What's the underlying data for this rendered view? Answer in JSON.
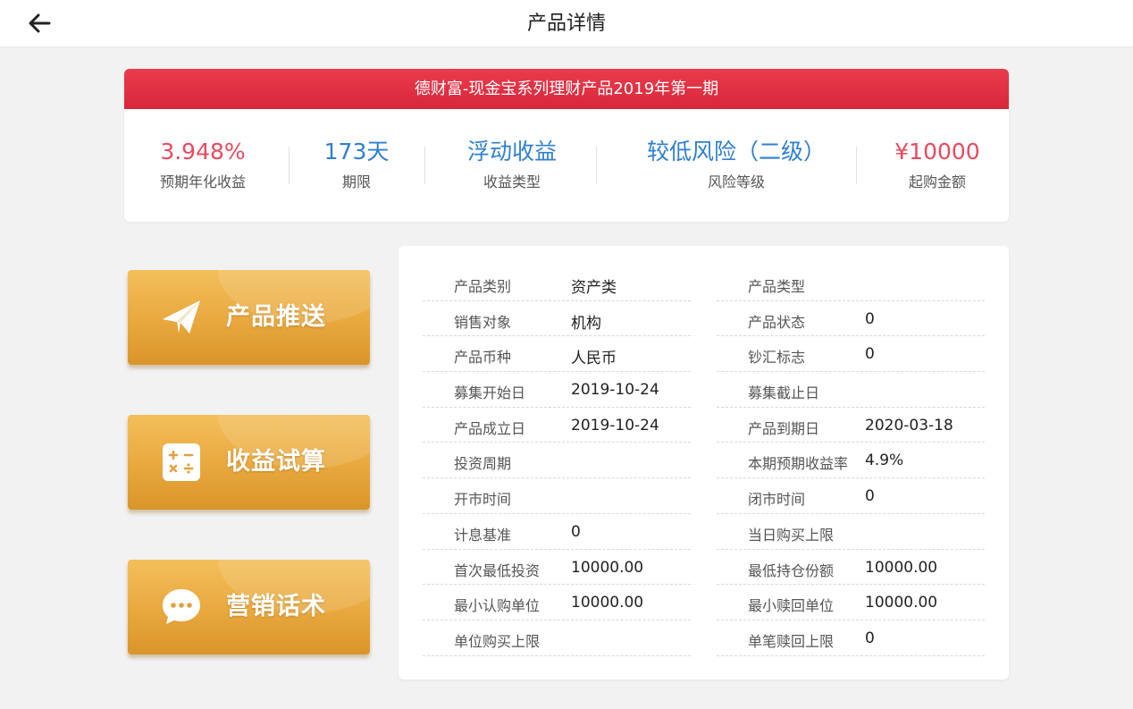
{
  "header": {
    "title": "产品详情",
    "back_icon": "arrow-left-icon"
  },
  "product": {
    "name": "德财富-现金宝系列理财产品2019年第一期",
    "stats": [
      {
        "value": "3.948%",
        "label": "预期年化收益",
        "color": "#e84a5f"
      },
      {
        "value": "173天",
        "label": "期限",
        "color": "#2f7fd0"
      },
      {
        "value": "浮动收益",
        "label": "收益类型",
        "color": "#2f7fd0"
      },
      {
        "value": "较低风险（二级）",
        "label": "风险等级",
        "color": "#2f7fd0"
      },
      {
        "value": "¥10000",
        "label": "起购金额",
        "color": "#e84a5f"
      }
    ]
  },
  "actions": [
    {
      "label": "产品推送",
      "icon": "paper-plane-icon"
    },
    {
      "label": "收益试算",
      "icon": "calculator-icon"
    },
    {
      "label": "营销话术",
      "icon": "chat-bubble-icon"
    }
  ],
  "details": {
    "left": [
      {
        "key": "产品类别",
        "value": "资产类"
      },
      {
        "key": "销售对象",
        "value": "机构"
      },
      {
        "key": "产品币种",
        "value": "人民币"
      },
      {
        "key": "募集开始日",
        "value": "2019-10-24"
      },
      {
        "key": "产品成立日",
        "value": "2019-10-24"
      },
      {
        "key": "投资周期",
        "value": ""
      },
      {
        "key": "开市时间",
        "value": ""
      },
      {
        "key": "计息基准",
        "value": "0"
      },
      {
        "key": "首次最低投资",
        "value": "10000.00"
      },
      {
        "key": "最小认购单位",
        "value": "10000.00"
      },
      {
        "key": "单位购买上限",
        "value": ""
      }
    ],
    "right": [
      {
        "key": "产品类型",
        "value": ""
      },
      {
        "key": "产品状态",
        "value": "0"
      },
      {
        "key": "钞汇标志",
        "value": "0"
      },
      {
        "key": "募集截止日",
        "value": ""
      },
      {
        "key": "产品到期日",
        "value": "2020-03-18"
      },
      {
        "key": "本期预期收益率",
        "value": "4.9%"
      },
      {
        "key": "闭市时间",
        "value": "0"
      },
      {
        "key": "当日购买上限",
        "value": ""
      },
      {
        "key": "最低持仓份额",
        "value": "10000.00"
      },
      {
        "key": "最小赎回单位",
        "value": "10000.00"
      },
      {
        "key": "单笔赎回上限",
        "value": "0"
      }
    ]
  },
  "colors": {
    "header_red": "#e0303f",
    "button_gold": "#e8a83e",
    "value_red": "#e84a5f",
    "value_blue": "#2f7fd0"
  }
}
